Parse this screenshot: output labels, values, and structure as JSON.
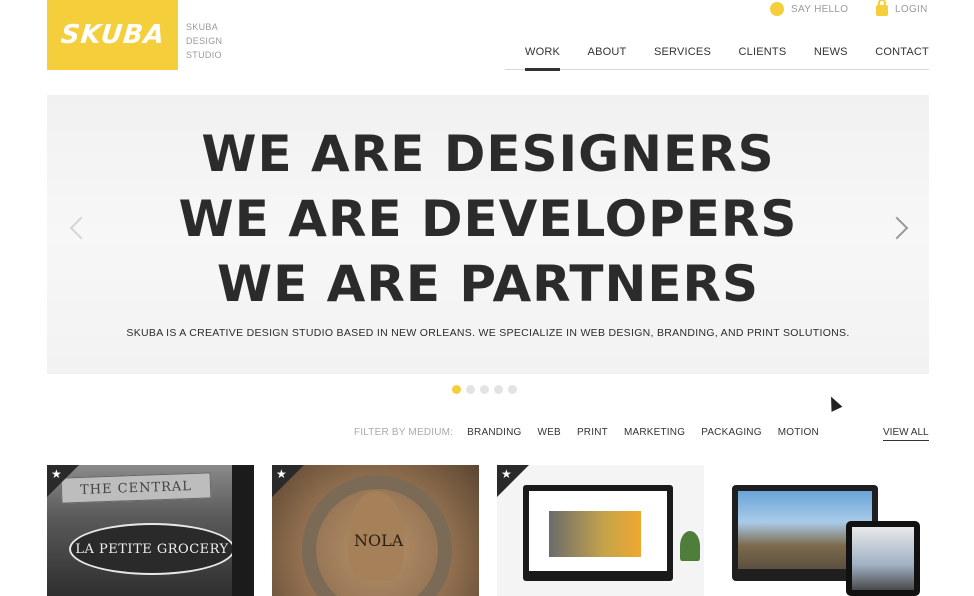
{
  "logo": {
    "text": "SKUBA"
  },
  "tagline": [
    "SKUBA",
    "DESIGN",
    "STUDIO"
  ],
  "utility": {
    "say_hello": "SAY HELLO",
    "login": "LOGIN"
  },
  "nav": {
    "items": [
      {
        "label": "WORK",
        "active": true
      },
      {
        "label": "ABOUT",
        "active": false
      },
      {
        "label": "SERVICES",
        "active": false
      },
      {
        "label": "CLIENTS",
        "active": false
      },
      {
        "label": "NEWS",
        "active": false
      },
      {
        "label": "CONTACT",
        "active": false
      }
    ]
  },
  "hero": {
    "lines": [
      "WE ARE DESIGNERS",
      "WE ARE DEVELOPERS",
      "WE ARE PARTNERS"
    ],
    "subtitle": "SKUBA IS A CREATIVE DESIGN STUDIO BASED IN NEW ORLEANS. WE SPECIALIZE IN WEB DESIGN, BRANDING, AND PRINT SOLUTIONS."
  },
  "carousel": {
    "slide_count": 5,
    "active_index": 0
  },
  "filter": {
    "label": "FILTER BY MEDIUM:",
    "items": [
      "BRANDING",
      "WEB",
      "PRINT",
      "MARKETING",
      "PACKAGING",
      "MOTION"
    ],
    "view_all": "VIEW ALL"
  },
  "portfolio": {
    "items": [
      {
        "sign": "THE CENTRAL",
        "title": "LA PETITE GROCERY",
        "featured": true
      },
      {
        "title": "NOLA",
        "featured": true
      },
      {
        "featured": true
      },
      {
        "featured": false
      }
    ]
  },
  "colors": {
    "accent": "#f5cf3b",
    "text": "#2b2b2b"
  }
}
